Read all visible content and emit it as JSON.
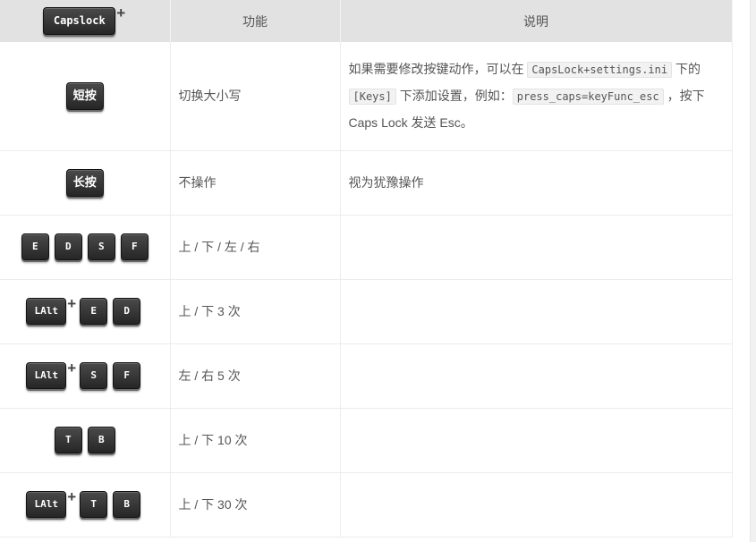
{
  "header": {
    "key": "Capslock",
    "plus": "+",
    "col_func": "功能",
    "col_desc": "说明"
  },
  "rows": [
    {
      "keys": [
        "短按"
      ],
      "func": "切换大小写",
      "desc": {
        "t1": "如果需要修改按键动作，可以在",
        "c1": "CapsLock+settings.ini",
        "t2": "下的",
        "c2": "[Keys]",
        "t3": "下添加设置，例如：",
        "c3": "press_caps=keyFunc_esc",
        "t4": "，按下 Caps Lock 发送 Esc。"
      }
    },
    {
      "keys": [
        "长按"
      ],
      "func": "不操作",
      "desc": "视为犹豫操作"
    },
    {
      "keys": [
        "E",
        "D",
        "S",
        "F"
      ],
      "func": "上 / 下 / 左 / 右",
      "desc": ""
    },
    {
      "keys": [
        "LAlt",
        "+",
        "E",
        "D"
      ],
      "func": "上 / 下 3 次",
      "desc": ""
    },
    {
      "keys": [
        "LAlt",
        "+",
        "S",
        "F"
      ],
      "func": "左 / 右 5 次",
      "desc": ""
    },
    {
      "keys": [
        "T",
        "B"
      ],
      "func": "上 / 下 10 次",
      "desc": ""
    },
    {
      "keys": [
        "LAlt",
        "+",
        "T",
        "B"
      ],
      "func": "上 / 下 30 次",
      "desc": ""
    }
  ]
}
